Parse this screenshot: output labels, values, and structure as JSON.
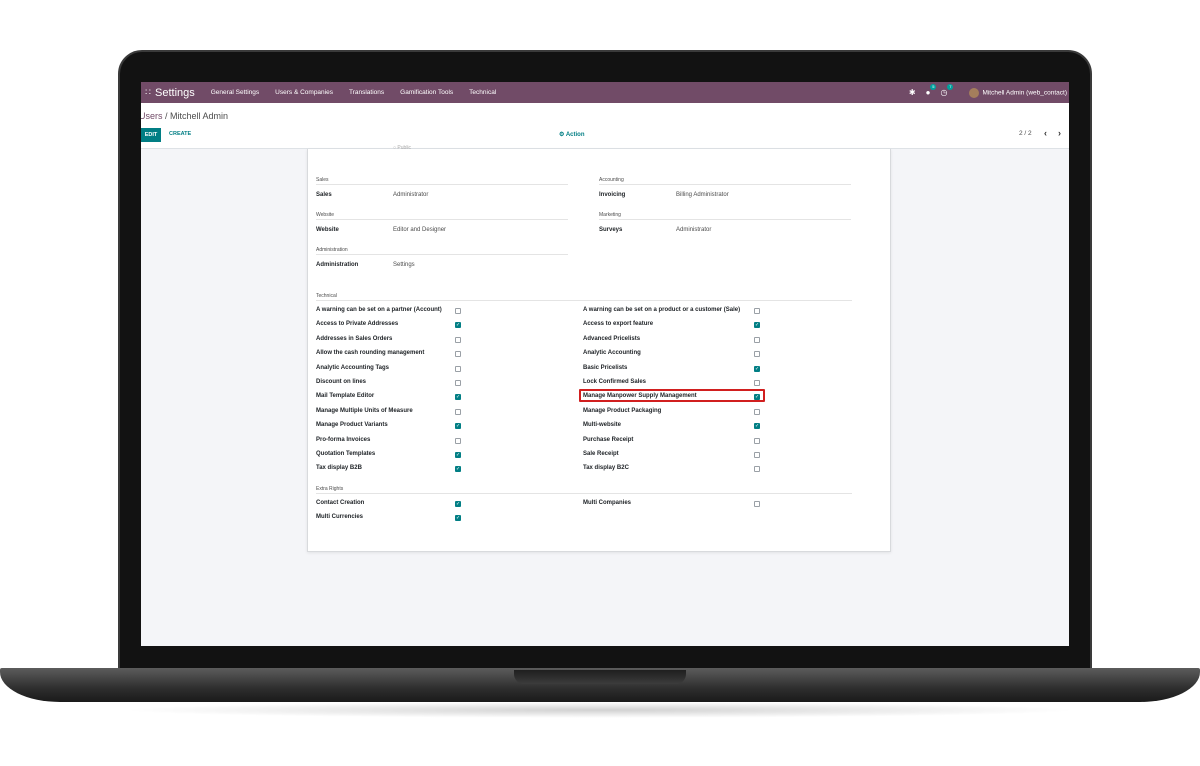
{
  "navbar": {
    "app_title": "Settings",
    "menu": [
      "General Settings",
      "Users & Companies",
      "Translations",
      "Gamification Tools",
      "Technical"
    ],
    "messages_count": "5",
    "activity_count": "7",
    "user_name": "Mitchell Admin (web_contact)"
  },
  "control_panel": {
    "breadcrumb_parent": "Users",
    "breadcrumb_separator": " / ",
    "breadcrumb_current": "Mitchell Admin",
    "edit_label": "EDIT",
    "create_label": "CREATE",
    "action_label": "Action",
    "pager": "2 / 2"
  },
  "faded_text": "Public",
  "app_access": {
    "left": [
      {
        "group": "Sales",
        "label": "Sales",
        "value": "Administrator"
      },
      {
        "group": "Website",
        "label": "Website",
        "value": "Editor and Designer"
      },
      {
        "group": "Administration",
        "label": "Administration",
        "value": "Settings"
      }
    ],
    "right": [
      {
        "group": "Accounting",
        "label": "Invoicing",
        "value": "Billing Administrator"
      },
      {
        "group": "Marketing",
        "label": "Surveys",
        "value": "Administrator"
      }
    ]
  },
  "technical": {
    "title": "Technical",
    "left": [
      {
        "label": "A warning can be set on a partner (Account)",
        "checked": false
      },
      {
        "label": "Access to Private Addresses",
        "checked": true
      },
      {
        "label": "Addresses in Sales Orders",
        "checked": false
      },
      {
        "label": "Allow the cash rounding management",
        "checked": false
      },
      {
        "label": "Analytic Accounting Tags",
        "checked": false
      },
      {
        "label": "Discount on lines",
        "checked": false
      },
      {
        "label": "Mail Template Editor",
        "checked": true
      },
      {
        "label": "Manage Multiple Units of Measure",
        "checked": false
      },
      {
        "label": "Manage Product Variants",
        "checked": true
      },
      {
        "label": "Pro-forma Invoices",
        "checked": false
      },
      {
        "label": "Quotation Templates",
        "checked": true
      },
      {
        "label": "Tax display B2B",
        "checked": true
      }
    ],
    "right": [
      {
        "label": "A warning can be set on a product or a customer (Sale)",
        "checked": false
      },
      {
        "label": "Access to export feature",
        "checked": true
      },
      {
        "label": "Advanced Pricelists",
        "checked": false
      },
      {
        "label": "Analytic Accounting",
        "checked": false
      },
      {
        "label": "Basic Pricelists",
        "checked": true
      },
      {
        "label": "Lock Confirmed Sales",
        "checked": false
      },
      {
        "label": "Manage Manpower Supply Management",
        "checked": true
      },
      {
        "label": "Manage Product Packaging",
        "checked": false
      },
      {
        "label": "Multi-website",
        "checked": true
      },
      {
        "label": "Purchase Receipt",
        "checked": false
      },
      {
        "label": "Sale Receipt",
        "checked": false
      },
      {
        "label": "Tax display B2C",
        "checked": false
      }
    ]
  },
  "extra_rights": {
    "title": "Extra Rights",
    "left": [
      {
        "label": "Contact Creation",
        "checked": true
      },
      {
        "label": "Multi Currencies",
        "checked": true
      }
    ],
    "right": [
      {
        "label": "Multi Companies",
        "checked": false
      }
    ]
  },
  "colors": {
    "navbar": "#714b67",
    "accent": "#017e84",
    "highlight": "#d11f1f"
  },
  "icons": [
    "apps-grid-icon",
    "bug-icon",
    "chat-icon",
    "clock-icon",
    "gear-icon",
    "chevron-left-icon",
    "chevron-right-icon"
  ]
}
